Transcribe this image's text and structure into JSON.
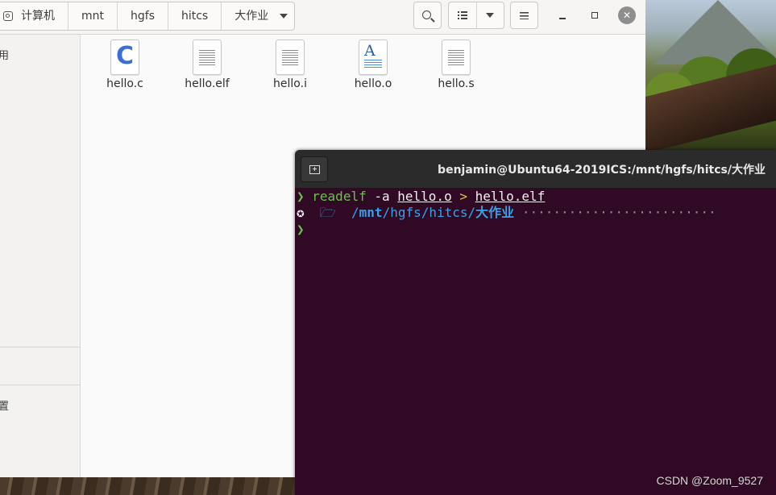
{
  "file_manager": {
    "breadcrumbs": [
      "计算机",
      "mnt",
      "hgfs",
      "hitcs",
      "大作业"
    ],
    "files": [
      {
        "name": "hello.c",
        "icon": "c-source-file-icon"
      },
      {
        "name": "hello.elf",
        "icon": "text-file-icon"
      },
      {
        "name": "hello.i",
        "icon": "text-file-icon"
      },
      {
        "name": "hello.o",
        "icon": "object-file-icon"
      },
      {
        "name": "hello.s",
        "icon": "text-file-icon"
      }
    ],
    "sidebar": {
      "partial_item_1": "用",
      "partial_item_2": "置"
    }
  },
  "terminal": {
    "title": "benjamin@Ubuntu64-2019ICS:/mnt/hgfs/hitcs/大作业",
    "prompt_symbol": "❯",
    "command": {
      "name": "readelf",
      "flag": "-a",
      "input": "hello.o",
      "redirect": ">",
      "output": "hello.elf"
    },
    "cwd_prefix": "/",
    "cwd_bold": "mnt",
    "cwd_rest": "/hgfs/hitcs/",
    "cwd_last": "大作业",
    "os_glyph": "ubuntu-logo-icon",
    "folder_glyph": "folder-open-icon"
  },
  "watermark": "CSDN @Zoom_9527"
}
